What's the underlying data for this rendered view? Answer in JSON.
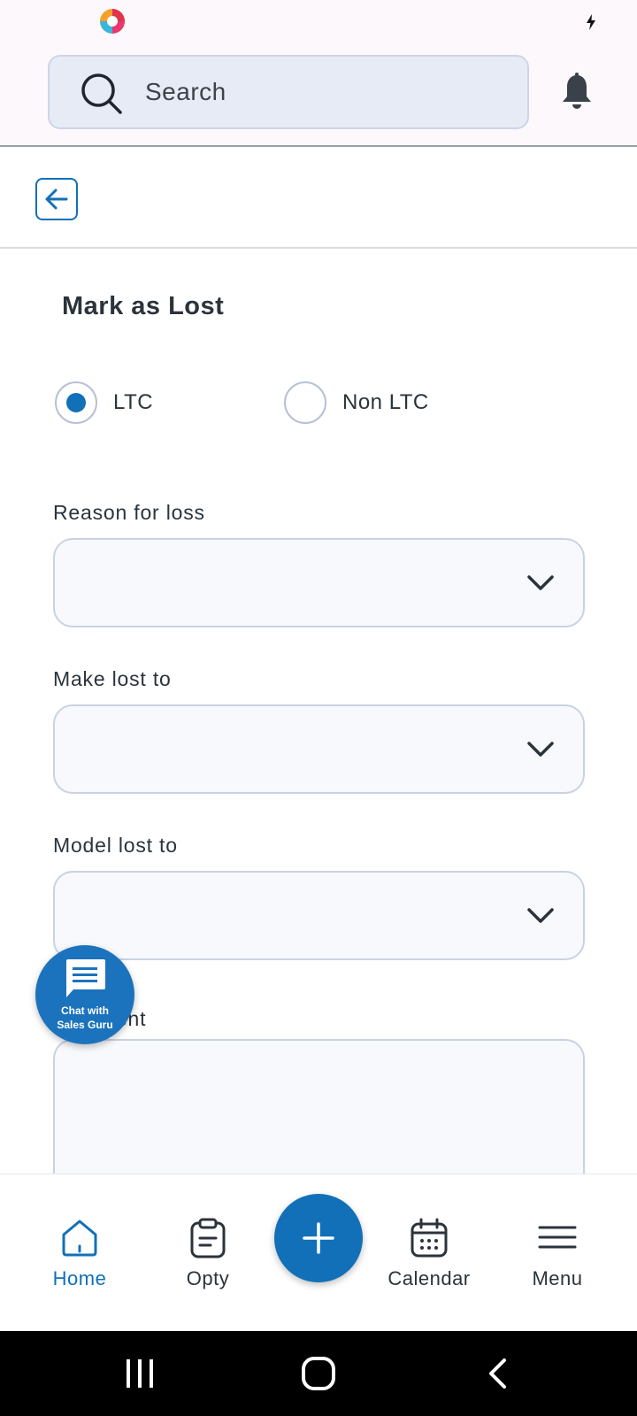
{
  "header": {
    "search_placeholder": "Search"
  },
  "form": {
    "title": "Mark as Lost",
    "radio_options": [
      {
        "label": "LTC",
        "selected": true
      },
      {
        "label": "Non LTC",
        "selected": false
      }
    ],
    "reason_label": "Reason for loss",
    "reason_value": "",
    "make_label": "Make lost to",
    "make_value": "",
    "model_label": "Model lost to",
    "model_value": "",
    "comment_label": "Comment",
    "comment_value": ""
  },
  "chat_fab": {
    "line1": "Chat with",
    "line2": "Sales Guru"
  },
  "bottom_nav": {
    "items": [
      {
        "label": "Home",
        "icon": "home-icon",
        "active": true
      },
      {
        "label": "Opty",
        "icon": "clipboard-icon",
        "active": false
      },
      {
        "label": "Calendar",
        "icon": "calendar-icon",
        "active": false
      },
      {
        "label": "Menu",
        "icon": "hamburger-icon",
        "active": false
      }
    ],
    "add_icon": "plus-icon"
  },
  "colors": {
    "accent": "#1170b8",
    "header_bg": "#fdf8fc",
    "search_bg": "#e7ebf6",
    "field_border": "#c9d2e4"
  }
}
